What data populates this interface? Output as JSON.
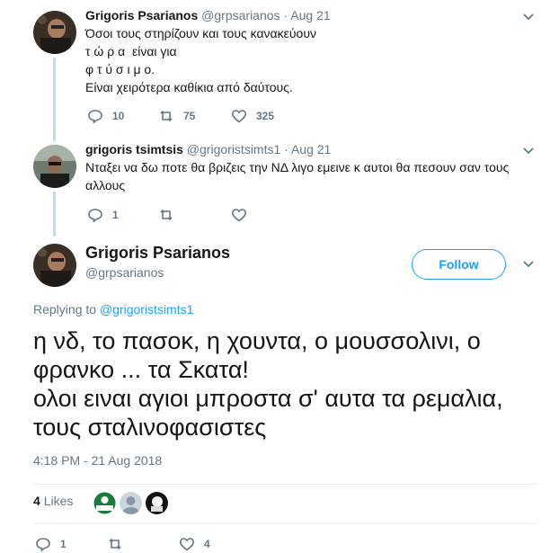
{
  "tweets": [
    {
      "name": "Grigoris Psarianos",
      "handle": "@grpsarianos",
      "dot": "·",
      "date": "Aug 21",
      "lines": [
        "Όσοι τους στηρίζουν και τους κανακεύουν",
        "τ ώ ρ α  είναι για",
        "φ τ ύ σ ι μ ο.",
        "Είναι χειρότερα καθίκια από δαύτους."
      ],
      "replies": "10",
      "retweets": "75",
      "likes": "325"
    },
    {
      "name": "grigoris tsimtsis",
      "handle": "@grigoristsimts1",
      "dot": "·",
      "date": "Aug 21",
      "lines": [
        "Νταξει να δω ποτε θα βριζεις την ΝΔ λιγο εμεινε κ αυτοι θα πεσουν σαν τους",
        "αλλους"
      ],
      "replies": "1",
      "retweets": "",
      "likes": ""
    }
  ],
  "main": {
    "name": "Grigoris Psarianos",
    "handle": "@grpsarianos",
    "follow_label": "Follow",
    "replying_prefix": "Replying to",
    "replying_to": "@grigoristsimts1",
    "text_lines": [
      "η νδ, το πασοκ, η χουντα, ο μουσσολινι, ο",
      "φρανκο ... τα Σκατα!",
      "ολοι ειναι αγιοι μπροστα σ' αυτα τα ρεμαλια,",
      "τους σταλινοφασιστες"
    ],
    "timestamp": "4:18 PM - 21 Aug 2018",
    "likes_count": "4",
    "likes_label": "Likes",
    "replies": "1",
    "retweets": "",
    "likes": "4"
  },
  "colors": {
    "accent": "#1da1f2",
    "thread_line": "#b7def7",
    "muted": "#657786"
  }
}
